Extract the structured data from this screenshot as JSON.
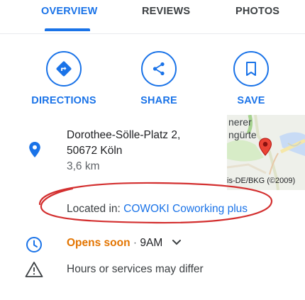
{
  "tabs": [
    {
      "label": "OVERVIEW",
      "active": true
    },
    {
      "label": "REVIEWS",
      "active": false
    },
    {
      "label": "PHOTOS",
      "active": false
    }
  ],
  "actions": {
    "directions": {
      "label": "DIRECTIONS",
      "icon": "directions-icon"
    },
    "share": {
      "label": "SHARE",
      "icon": "share-icon"
    },
    "save": {
      "label": "SAVE",
      "icon": "bookmark-icon"
    }
  },
  "address": {
    "line1": "Dorothee-Sölle-Platz 2,",
    "line2": "50672 Köln",
    "distance": "3,6 km",
    "icon": "location-pin-icon"
  },
  "map": {
    "label_top": "nerer",
    "label_bottom": "ngürte",
    "credit": "is-DE/BKG (©2009)"
  },
  "located_in": {
    "prefix": "Located in: ",
    "place": "COWOKI Coworking plus"
  },
  "hours": {
    "status": "Opens soon",
    "separator": " · ",
    "time": "9AM",
    "icon": "clock-icon"
  },
  "notice": {
    "text": "Hours or services may differ",
    "icon": "warning-icon"
  },
  "colors": {
    "accent": "#1a73e8",
    "opens_soon": "#e37400",
    "annotation": "#d32f2f"
  }
}
